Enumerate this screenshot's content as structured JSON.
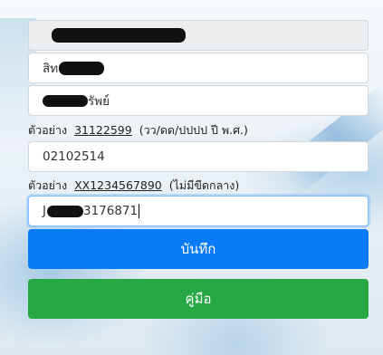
{
  "form": {
    "field1": {
      "value": ""
    },
    "field2": {
      "value_prefix": "สิท"
    },
    "field3": {
      "value_suffix": "รัพย์"
    },
    "hint1": {
      "label": "ตัวอย่าง",
      "example": "31122599",
      "note": "(วว/ดด/ปปปป ปี พ.ศ.)"
    },
    "date_field": {
      "value": "02102514"
    },
    "hint2": {
      "label": "ตัวอย่าง",
      "example": "XX1234567890",
      "note": "(ไม่มีขีดกลาง)"
    },
    "id_field": {
      "value_prefix": "J",
      "value_suffix": "3176871"
    }
  },
  "buttons": {
    "save_label": "บันทึก",
    "manual_label": "คู่มือ"
  },
  "colors": {
    "save_button": "#0a7bf7",
    "manual_button": "#28a745",
    "focus_border": "#80bdff"
  }
}
